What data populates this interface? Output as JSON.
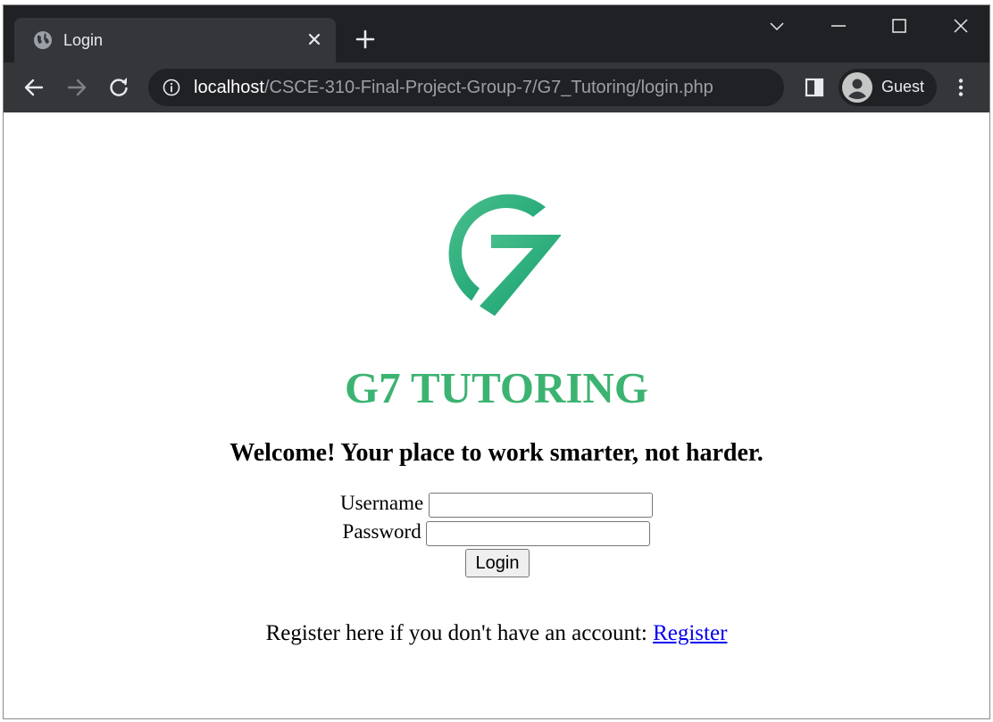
{
  "browser": {
    "tab": {
      "title": "Login",
      "favicon": "globe-icon"
    },
    "url": {
      "host": "localhost",
      "path": "/CSCE-310-Final-Project-Group-7/G7_Tutoring/login.php"
    },
    "profile_label": "Guest",
    "theme_colors": {
      "titlebar": "#202124",
      "toolbar": "#35363a",
      "text": "#e8eaed"
    }
  },
  "page": {
    "logo": "G7 logo",
    "brand_title": "G7 TUTORING",
    "welcome": "Welcome! Your place to work smarter, not harder.",
    "form": {
      "username_label": "Username",
      "username_value": "",
      "password_label": "Password",
      "password_value": "",
      "login_label": "Login"
    },
    "register_prompt": "Register here if you don't have an account: ",
    "register_link": "Register",
    "colors": {
      "brand": "#3cb371",
      "link": "#0000ee",
      "logo_light": "#4cc08e",
      "logo_dark": "#0e9b6b"
    }
  }
}
